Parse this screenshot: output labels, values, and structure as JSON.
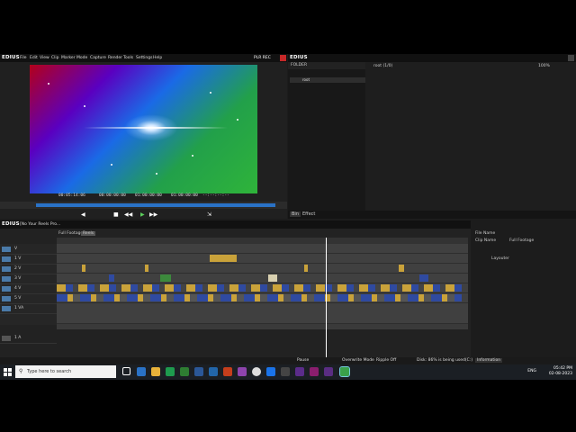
{
  "player": {
    "logo": "EDIUS",
    "menu": [
      "File",
      "Edit",
      "View",
      "Clip",
      "Marker",
      "Mode",
      "Capture",
      "Render",
      "Tools",
      "Settings",
      "Help"
    ],
    "mode": "PLR REC",
    "timecodes": {
      "cur": "00:05:14:06",
      "in": "00:00:00:00",
      "out": "01:00:00:00",
      "dur": "--:--:--:--"
    }
  },
  "bin": {
    "logo": "EDIUS",
    "folder_label": "FOLDER",
    "root_path": "root (1/0)",
    "zoom": "100%",
    "root_item": "root",
    "bottom_tabs": [
      "Bin",
      "Effect"
    ]
  },
  "timeline": {
    "logo": "EDIUS",
    "project": "[No Your Reels Pro...",
    "tabs": [
      "Full Footage",
      "Reels"
    ],
    "tracks": [
      "V",
      "1 V",
      "2 V",
      "3 V",
      "4 V",
      "5 V",
      "1 VA",
      "1 A"
    ],
    "audio_clips": [
      "Pal Hai Na Yaaraa - Title ... Judd Singh ... Song(MP3_128K)",
      "Meri ID Brahma Dipak Ka ... Bando Boe ... Beat(MP3_128K)",
      "Vio Mashi ... Shaan ... Minimal Humor ... Patanjali Chand(MP3_128K)"
    ]
  },
  "info": {
    "file_name_label": "File Name",
    "clip_name_label": "Clip Name",
    "clip_name_value": "Full Footage",
    "layouter": "Layouter"
  },
  "status": {
    "mode": "Overwrite Mode",
    "ripple": "Ripple Off",
    "disk": "Disk: 86% is being used(C:)",
    "pause": "Pause",
    "information_tab": "Information"
  },
  "taskbar": {
    "search_placeholder": "Type here to search",
    "lang": "ENG",
    "time": "05:42 PM",
    "date": "02-08-2023"
  },
  "colors": {
    "accent": "#2a72c6",
    "clip_yellow": "#c9a23a",
    "clip_blue": "#2f4aa0"
  }
}
